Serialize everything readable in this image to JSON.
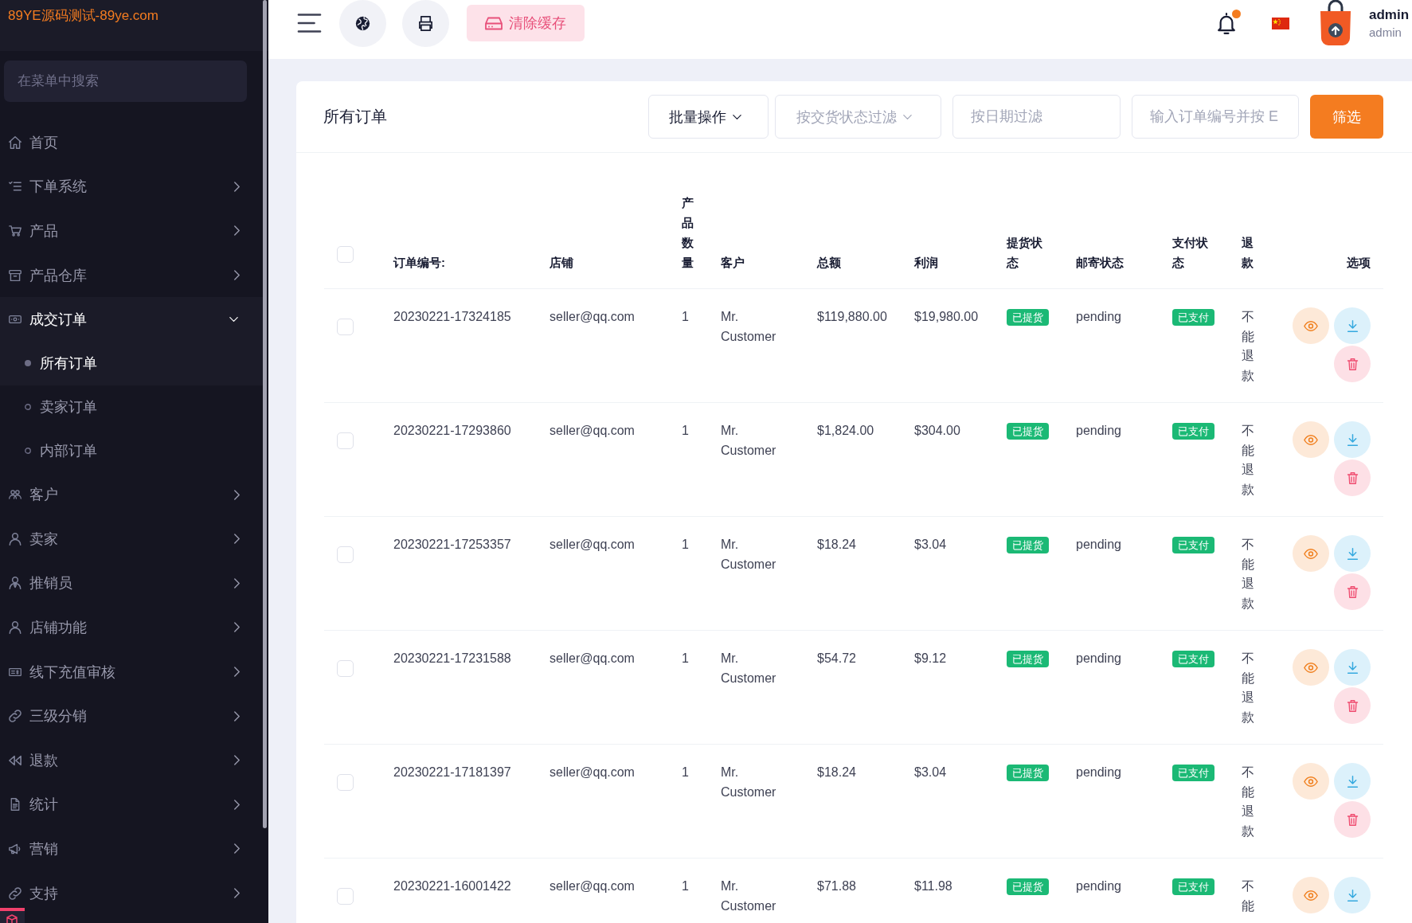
{
  "sidebar": {
    "logo": "89YE源码测试-89ye.com",
    "search": {
      "placeholder": "在菜单中搜索"
    },
    "items": [
      {
        "label": "首页",
        "kind": "link",
        "selected": false
      },
      {
        "label": "下单系统",
        "kind": "group",
        "expanded": false,
        "selected": false
      },
      {
        "label": "产品",
        "kind": "group",
        "expanded": false,
        "selected": false
      },
      {
        "label": "产品仓库",
        "kind": "group",
        "expanded": false,
        "selected": false
      },
      {
        "label": "成交订单",
        "kind": "group",
        "expanded": true,
        "selected": false,
        "children": [
          {
            "label": "所有订单",
            "selected": true
          },
          {
            "label": "卖家订单",
            "selected": false
          },
          {
            "label": "内部订单",
            "selected": false
          }
        ]
      },
      {
        "label": "客户",
        "kind": "group",
        "expanded": false,
        "selected": false
      },
      {
        "label": "卖家",
        "kind": "group",
        "expanded": false,
        "selected": false
      },
      {
        "label": "推销员",
        "kind": "group",
        "expanded": false,
        "selected": false
      },
      {
        "label": "店铺功能",
        "kind": "group",
        "expanded": false,
        "selected": false
      },
      {
        "label": "线下充值审核",
        "kind": "group",
        "expanded": false,
        "selected": false
      },
      {
        "label": "三级分销",
        "kind": "group",
        "expanded": false,
        "selected": false
      },
      {
        "label": "退款",
        "kind": "group",
        "expanded": false,
        "selected": false
      },
      {
        "label": "统计",
        "kind": "group",
        "expanded": false,
        "selected": false
      },
      {
        "label": "营销",
        "kind": "group",
        "expanded": false,
        "selected": false
      },
      {
        "label": "支持",
        "kind": "group",
        "expanded": false,
        "selected": false
      }
    ]
  },
  "topbar": {
    "clear_cache": "清除缓存",
    "notifications_unread": true,
    "user": {
      "name": "admin",
      "role": "admin"
    }
  },
  "card": {
    "title": "所有订单",
    "bulk_action": "批量操作",
    "delivery_filter": "按交货状态过滤",
    "date_filter": {
      "placeholder": "按日期过滤"
    },
    "order_search": {
      "placeholder": "输入订单编号并按 E"
    },
    "filter_button": "筛选"
  },
  "table": {
    "select_all": {
      "checked": false
    },
    "columns": [
      "订单编号:",
      "店铺",
      "产品数量",
      "客户",
      "总额",
      "利润",
      "提货状态",
      "邮寄状态",
      "支付状态",
      "退款",
      "选项"
    ],
    "rows": [
      {
        "selected": false,
        "order_no": "20230221-17324185",
        "shop": "seller@qq.com",
        "quantity": "1",
        "customer": "Mr. Customer",
        "total": "$119,880.00",
        "profit": "$19,980.00",
        "pickup_status": "已提货",
        "shipping_status": "pending",
        "payment_status": "已支付",
        "refund": "不能退款",
        "actions": [
          {
            "kind": "view"
          },
          {
            "kind": "download"
          },
          {
            "kind": "delete"
          }
        ]
      },
      {
        "selected": false,
        "order_no": "20230221-17293860",
        "shop": "seller@qq.com",
        "quantity": "1",
        "customer": "Mr. Customer",
        "total": "$1,824.00",
        "profit": "$304.00",
        "pickup_status": "已提货",
        "shipping_status": "pending",
        "payment_status": "已支付",
        "refund": "不能退款",
        "actions": [
          {
            "kind": "view"
          },
          {
            "kind": "download"
          },
          {
            "kind": "delete"
          }
        ]
      },
      {
        "selected": false,
        "order_no": "20230221-17253357",
        "shop": "seller@qq.com",
        "quantity": "1",
        "customer": "Mr. Customer",
        "total": "$18.24",
        "profit": "$3.04",
        "pickup_status": "已提货",
        "shipping_status": "pending",
        "payment_status": "已支付",
        "refund": "不能退款",
        "actions": [
          {
            "kind": "view"
          },
          {
            "kind": "download"
          },
          {
            "kind": "delete"
          }
        ]
      },
      {
        "selected": false,
        "order_no": "20230221-17231588",
        "shop": "seller@qq.com",
        "quantity": "1",
        "customer": "Mr. Customer",
        "total": "$54.72",
        "profit": "$9.12",
        "pickup_status": "已提货",
        "shipping_status": "pending",
        "payment_status": "已支付",
        "refund": "不能退款",
        "actions": [
          {
            "kind": "view"
          },
          {
            "kind": "download"
          },
          {
            "kind": "delete"
          }
        ]
      },
      {
        "selected": false,
        "order_no": "20230221-17181397",
        "shop": "seller@qq.com",
        "quantity": "1",
        "customer": "Mr. Customer",
        "total": "$18.24",
        "profit": "$3.04",
        "pickup_status": "已提货",
        "shipping_status": "pending",
        "payment_status": "已支付",
        "refund": "不能退款",
        "actions": [
          {
            "kind": "view"
          },
          {
            "kind": "download"
          },
          {
            "kind": "delete"
          }
        ]
      },
      {
        "selected": false,
        "order_no": "20230221-16001422",
        "shop": "seller@qq.com",
        "quantity": "1",
        "customer": "Mr. Customer",
        "total": "$71.88",
        "profit": "$11.98",
        "pickup_status": "已提货",
        "shipping_status": "pending",
        "payment_status": "已支付",
        "refund": "不能",
        "actions": [
          {
            "kind": "view"
          },
          {
            "kind": "download"
          }
        ]
      }
    ]
  }
}
